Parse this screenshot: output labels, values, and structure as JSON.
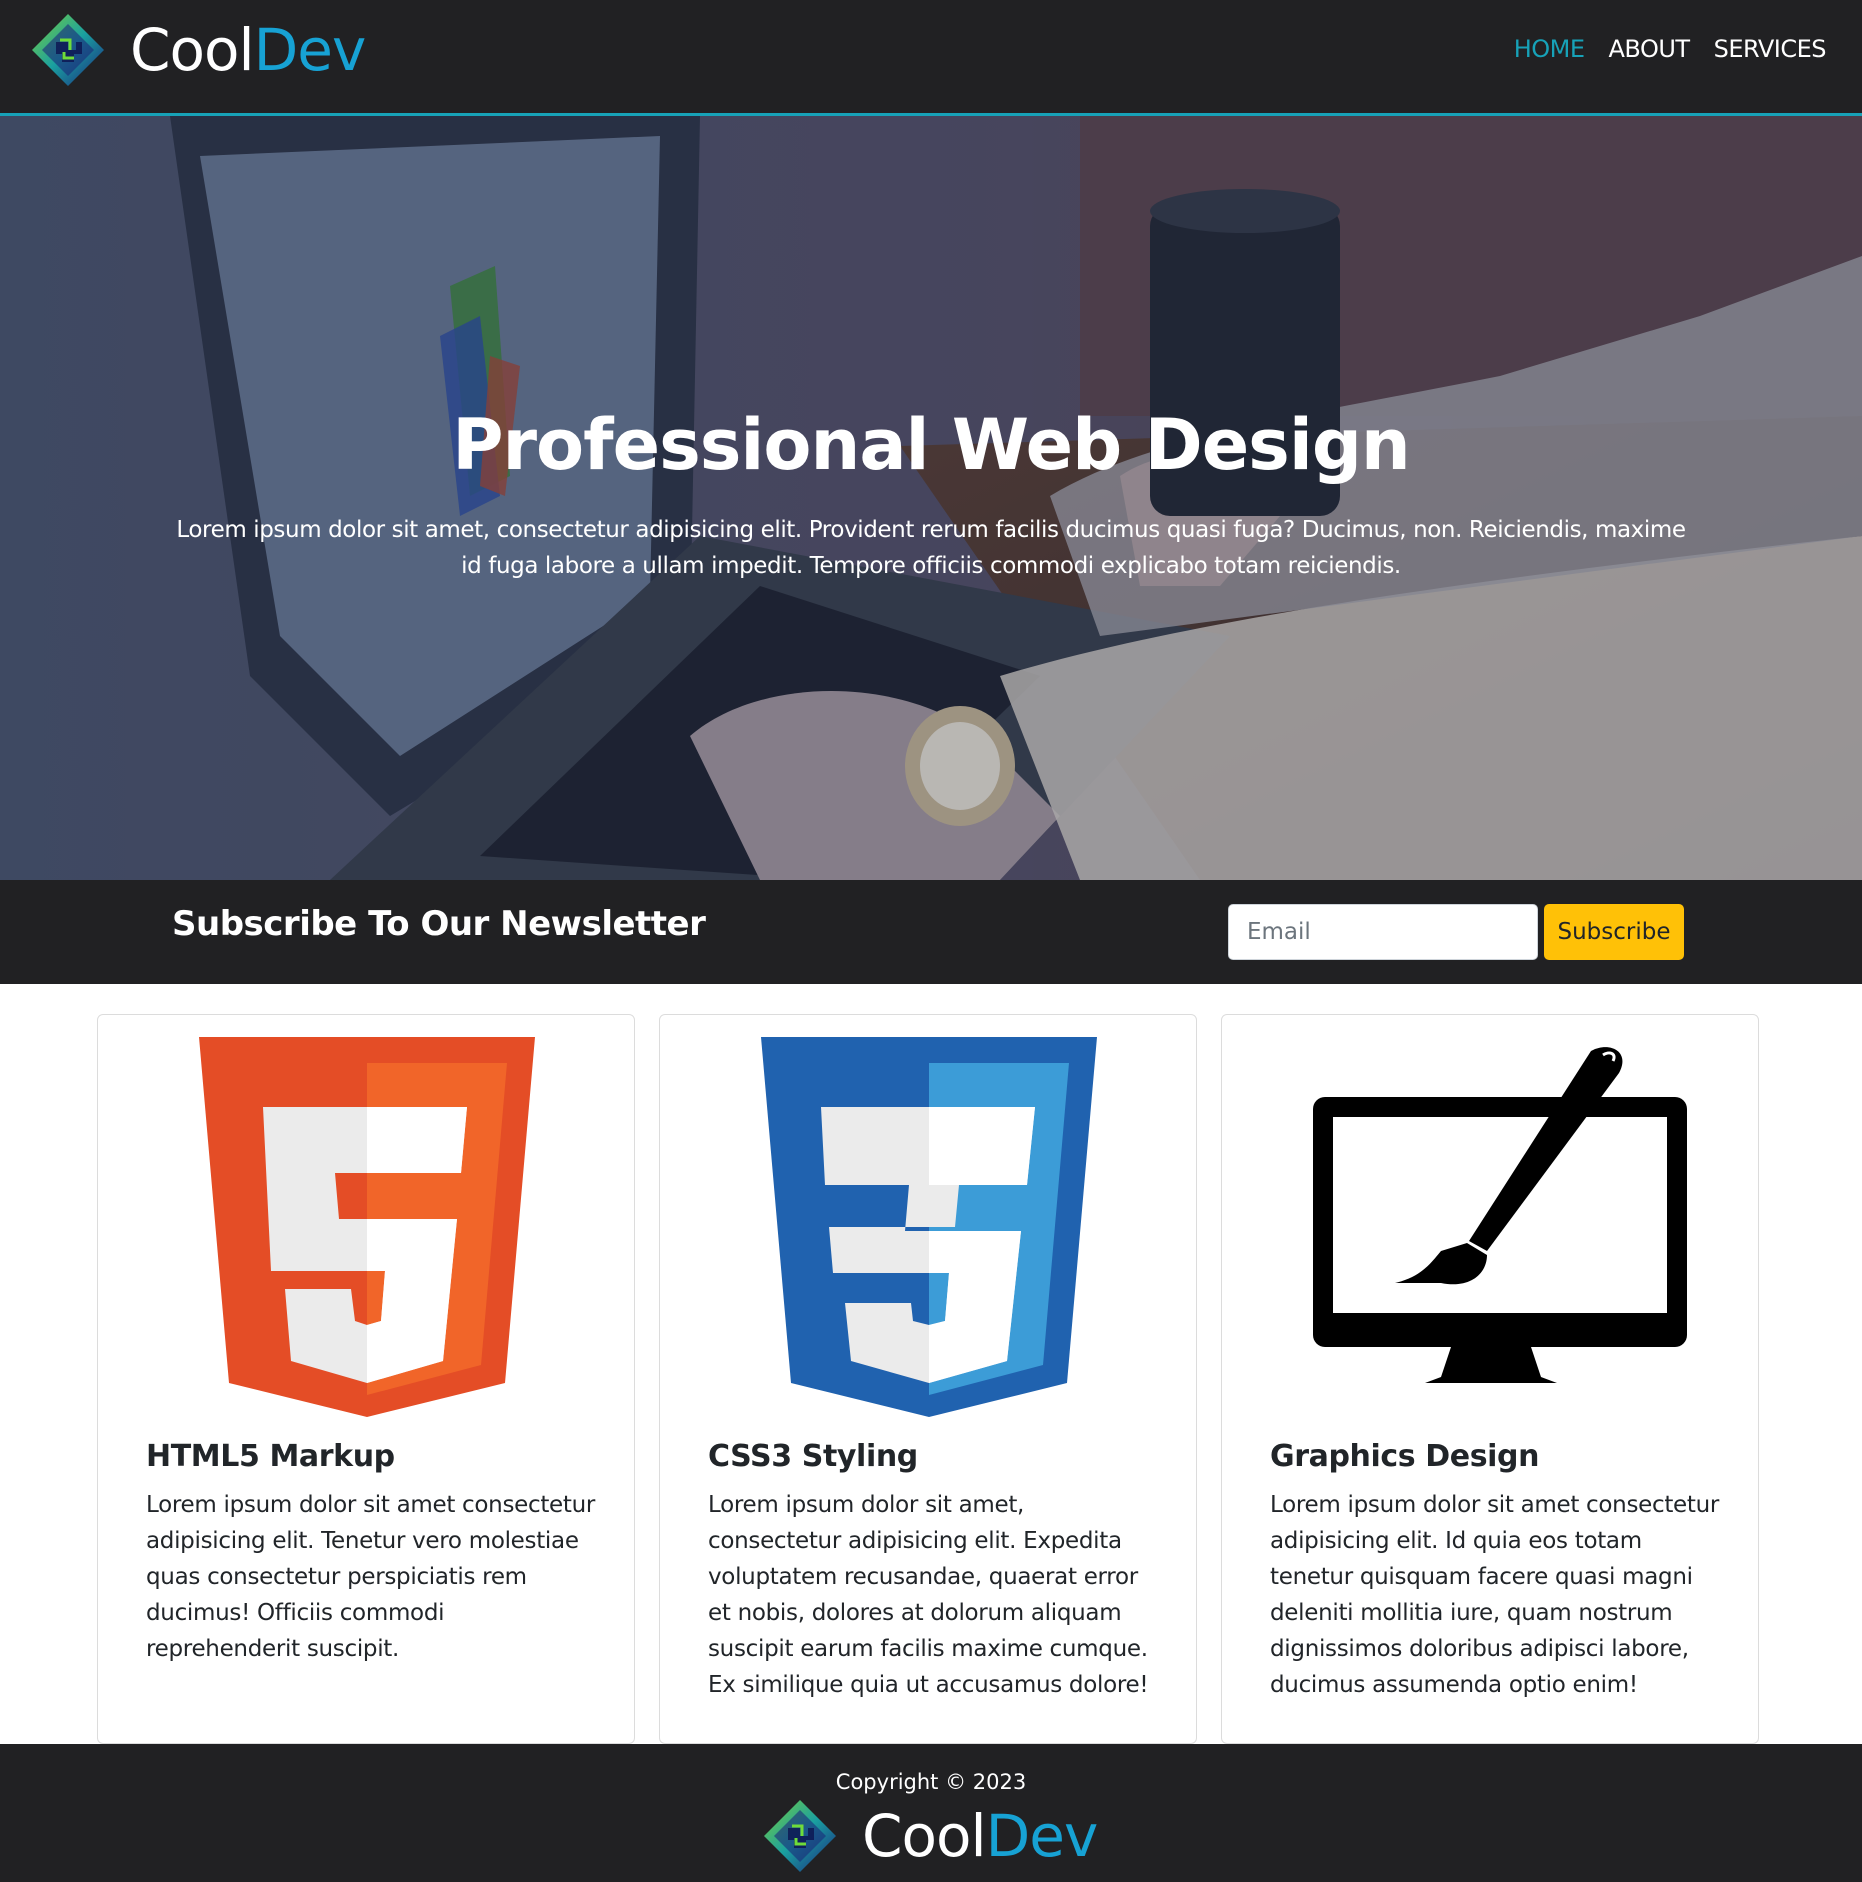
{
  "brand": {
    "name_part1": "Cool",
    "name_part2": "Dev"
  },
  "nav": {
    "items": [
      {
        "label": "HOME"
      },
      {
        "label": "ABOUT"
      },
      {
        "label": "SERVICES"
      }
    ]
  },
  "hero": {
    "title": "Professional Web Design",
    "text": "Lorem ipsum dolor sit amet, consectetur adipisicing elit. Provident rerum facilis ducimus quasi fuga? Ducimus, non. Reiciendis, maxime id fuga labore a ullam impedit. Tempore officiis commodi explicabo totam reiciendis."
  },
  "newsletter": {
    "title": "Subscribe To Our Newsletter",
    "email_placeholder": "Email",
    "button_label": "Subscribe"
  },
  "cards": [
    {
      "icon": "html5-logo",
      "title": "HTML5 Markup",
      "text": "Lorem ipsum dolor sit amet consectetur adipisicing elit. Tenetur vero molestiae quas consectetur perspiciatis rem ducimus! Officiis commodi reprehenderit suscipit."
    },
    {
      "icon": "css3-logo",
      "title": "CSS3 Styling",
      "text": "Lorem ipsum dolor sit amet, consectetur adipisicing elit. Expedita voluptatem recusandae, quaerat error et nobis, dolores at dolorum aliquam suscipit earum facilis maxime cumque. Ex similique quia ut accusamus dolore!"
    },
    {
      "icon": "monitor-paintbrush-icon",
      "title": "Graphics Design",
      "text": "Lorem ipsum dolor sit amet consectetur adipisicing elit. Id quia eos totam tenetur quisquam facere quasi magni deleniti mollitia iure, quam nostrum dignissimos doloribus adipisci labore, ducimus assumenda optio enim!"
    }
  ],
  "footer": {
    "copyright": "Copyright © 2023"
  },
  "colors": {
    "accent": "#17a2b8",
    "brand_blue": "#17a2d4",
    "dark_bg": "#212123",
    "button_yellow": "#ffc107",
    "html5_orange": "#e44d26",
    "css3_blue": "#1572b6"
  }
}
